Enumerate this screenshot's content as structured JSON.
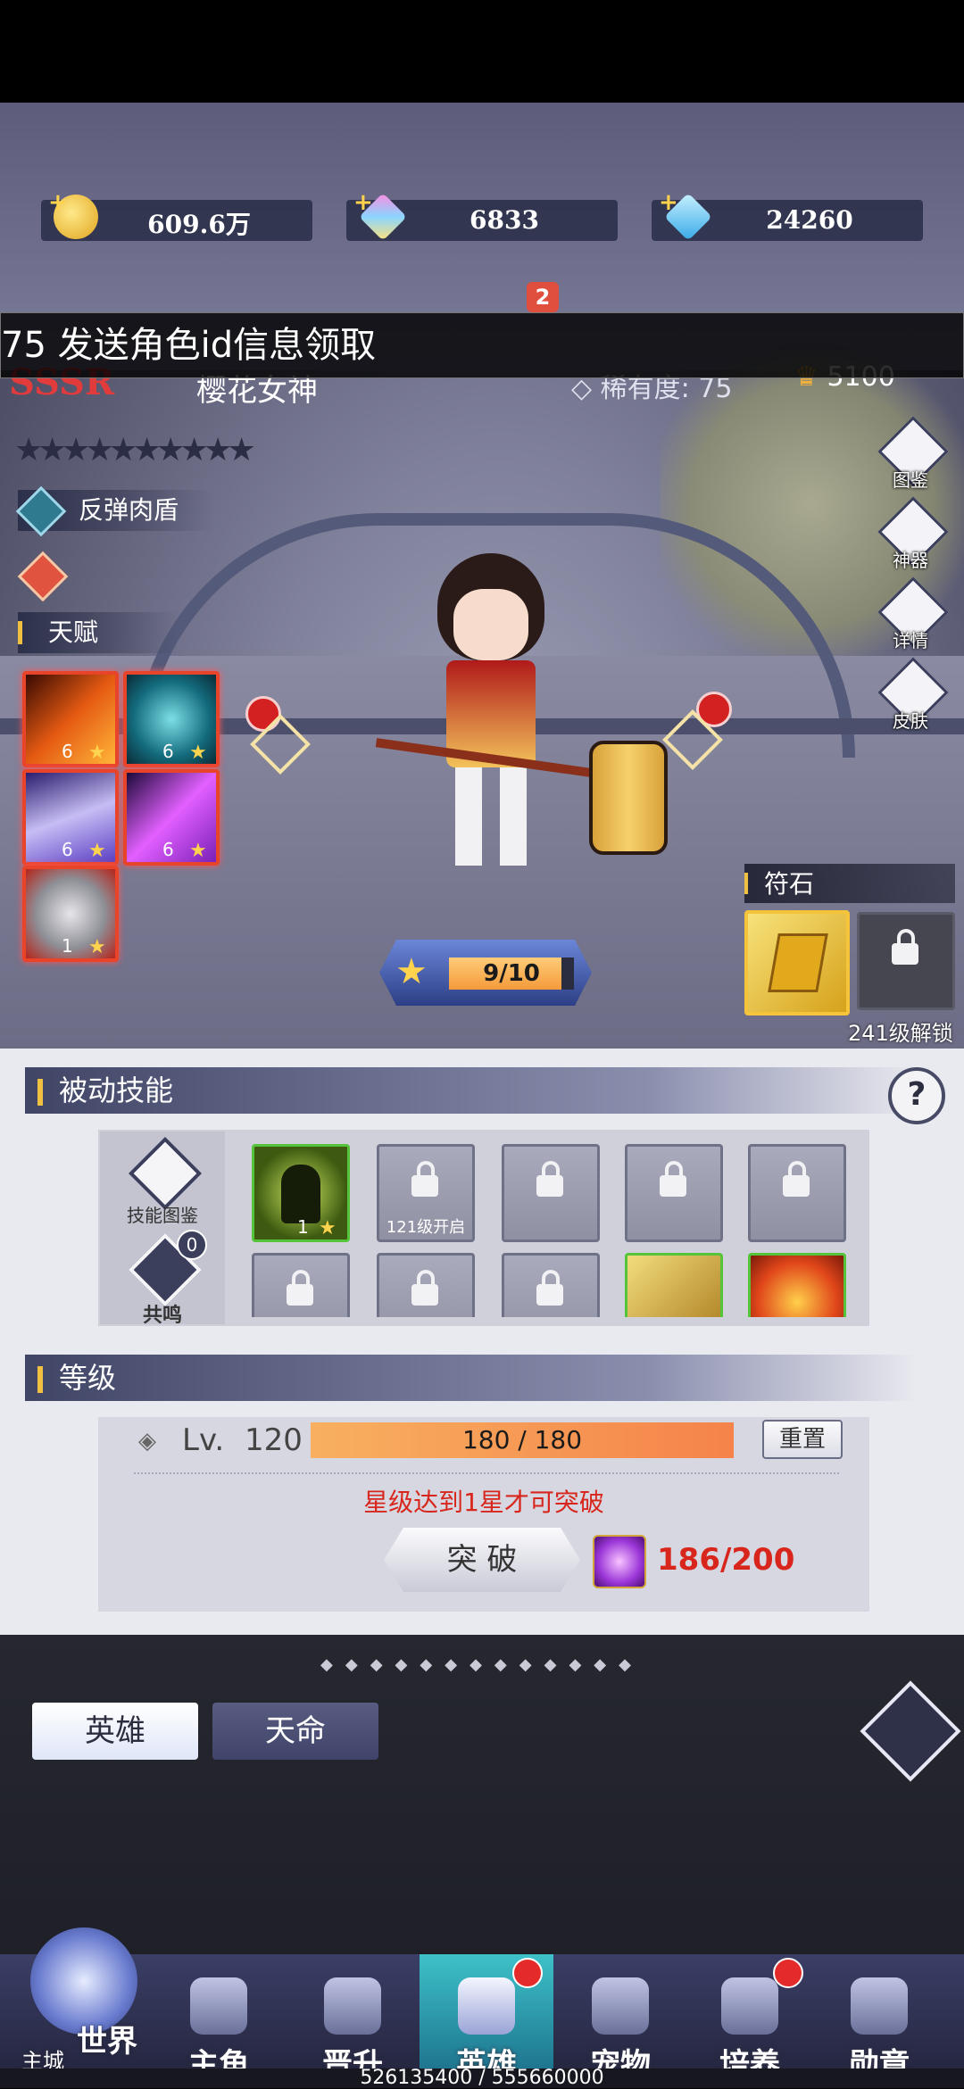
{
  "currency": {
    "gold": "609.6万",
    "crystal": "6833",
    "diamond": "24260"
  },
  "notice": {
    "badge": "2",
    "text": "75 发送角色id信息领取"
  },
  "hero": {
    "rank_partial": "SSSR",
    "name_partial": "樱花女神",
    "rarity_label": "稀有度:",
    "rarity_value": "75",
    "power": "5100",
    "stars_total": 10,
    "shield_skill": "反弹肉盾",
    "talent_label": "天赋"
  },
  "talent_skills": [
    {
      "icon": "fire-skill-icon",
      "level": "6"
    },
    {
      "icon": "spirit-skill-icon",
      "level": "6"
    },
    {
      "icon": "wind-skill-icon",
      "level": "6"
    },
    {
      "icon": "slash-skill-icon",
      "level": "6"
    },
    {
      "icon": "armor-skill-icon",
      "level": "1"
    }
  ],
  "side_buttons": [
    "图鉴",
    "神器",
    "详情",
    "皮肤"
  ],
  "star_progress": "9/10",
  "runes": {
    "label": "符石",
    "unlock_text": "241级解锁"
  },
  "passive": {
    "title": "被动技能",
    "help": "?",
    "skill_book": "技能图鉴",
    "resonance": "共鸣",
    "resonance_count": "0",
    "slots": [
      {
        "state": "owned",
        "level": "1",
        "caption": ""
      },
      {
        "state": "locked",
        "caption": "121级开启"
      },
      {
        "state": "locked",
        "caption": ""
      },
      {
        "state": "locked",
        "caption": ""
      },
      {
        "state": "locked",
        "caption": ""
      },
      {
        "state": "locked",
        "caption": ""
      },
      {
        "state": "locked",
        "caption": ""
      },
      {
        "state": "locked",
        "caption": ""
      },
      {
        "state": "special",
        "caption": ""
      },
      {
        "state": "special",
        "caption": ""
      }
    ]
  },
  "level": {
    "title": "等级",
    "lv_label": "Lv.",
    "lv_value": "120",
    "exp": "180 / 180",
    "exp_fraction": 1.0,
    "reset": "重置",
    "warning": "星级达到1星才可突破",
    "breakthrough": "突 破",
    "cost": "186/200"
  },
  "tabs": {
    "hero": "英雄",
    "destiny": "天命"
  },
  "nav": [
    {
      "label": "世界",
      "sub": "主城",
      "icon": "world-icon"
    },
    {
      "label": "主角",
      "icon": "protagonist-icon"
    },
    {
      "label": "晋升",
      "icon": "promote-icon"
    },
    {
      "label": "英雄",
      "icon": "hero-icon",
      "active": true,
      "dot": true
    },
    {
      "label": "宠物",
      "icon": "pet-icon"
    },
    {
      "label": "培养",
      "icon": "train-icon",
      "dot": true
    },
    {
      "label": "勋章",
      "icon": "medal-icon"
    }
  ],
  "footer_stats": "526135400 / 555660000",
  "colors": {
    "accent_red": "#e04e3e",
    "warning_red": "#d8261c",
    "exp_orange": "#f6a24a",
    "panel_bg": "#e9e9f0",
    "gold": "#ffd34d"
  }
}
